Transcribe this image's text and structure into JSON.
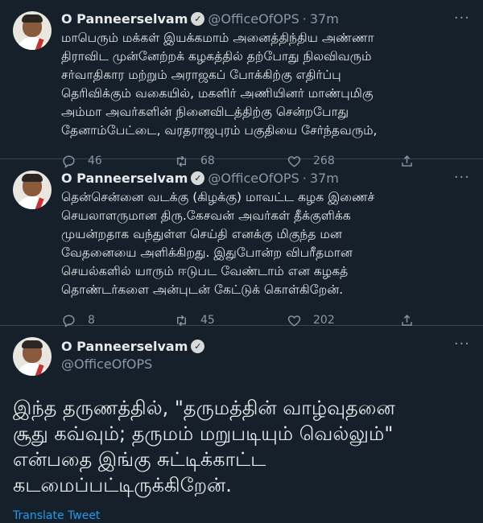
{
  "tweets": [
    {
      "name": "O Panneerselvam",
      "handle": "@OfficeOfOPS",
      "time": "37m",
      "text": "மாபெரும் மக்கள் இயக்கமாம் அனைத்திந்திய அண்ணா\nதிராவிட முன்னேற்றக் கழகத்தில் தற்போது நிலவிவரும்\nசர்வாதிகார மற்றும் அராஜகப் போக்கிற்கு எதிர்ப்பு\nதெரிவிக்கும் வகையில், மகளிர் அணியினர் மாண்புமிகு\nஅம்மா அவர்களின் நினைவிடத்திற்கு சென்றபோது\nதேனாம்பேட்டை, வரதராஜபுரம் பகுதியை சேர்ந்தவரும்,",
      "replies": "46",
      "retweets": "68",
      "likes": "268"
    },
    {
      "name": "O Panneerselvam",
      "handle": "@OfficeOfOPS",
      "time": "37m",
      "text": "தென்சென்னை வடக்கு (கிழக்கு) மாவட்ட கழக இணைச்\nசெயலாளருமான திரு.கேசவன் அவர்கள் தீக்குளிக்க\nமுயன்றதாக வந்துள்ள செய்தி எனக்கு மிகுந்த மன\nவேதனையை அளிக்கிறது. இதுபோன்ற விபரீதமான\nசெயல்களில் யாரும் ஈடுபட வேண்டாம் என கழகத்\nதொண்டர்களை அன்புடன் கேட்டுக் கொள்கிறேன்.",
      "replies": "8",
      "retweets": "45",
      "likes": "202"
    }
  ],
  "main_tweet": {
    "name": "O Panneerselvam",
    "handle": "@OfficeOfOPS",
    "text": "இந்த தருணத்தில், \"தருமத்தின் வாழ்வுதனை\nசூது கவ்வும்; தருமம் மறுபடியும் வெல்லும்\"\nஎன்பதை இங்கு சுட்டிக்காட்ட\nகடமைப்பட்டிருக்கிறேன்.",
    "translate_label": "Translate Tweet"
  },
  "icons": {
    "verified": "verified-badge-icon",
    "more": "more-icon",
    "reply": "reply-icon",
    "retweet": "retweet-icon",
    "like": "like-icon",
    "share": "share-icon"
  },
  "colors": {
    "background": "#15202b",
    "text": "#e7e9ea",
    "muted": "#8b98a5",
    "link": "#1d9bf0",
    "divider": "#38444d"
  }
}
